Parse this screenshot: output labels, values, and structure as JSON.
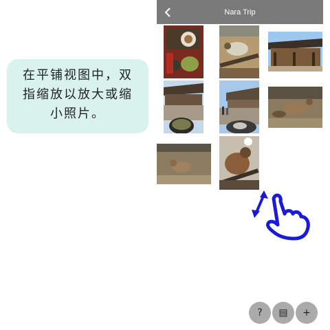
{
  "tooltip": {
    "lines": [
      "在平铺视图中，双",
      "指缩放以放大或缩",
      "小照片。"
    ]
  },
  "header": {
    "title": "Nara Trip",
    "back_icon": "chevron-left-icon"
  },
  "photos": [
    "photo-food-tray",
    "photo-deer-sheep",
    "photo-temple-gate",
    "photo-temple-hall",
    "photo-courtyard-people",
    "photo-deer-lying",
    "photo-deer-grass",
    "photo-deer-close",
    "photo-bowl-food"
  ],
  "fabs": [
    {
      "icon": "help-icon",
      "glyph": "?"
    },
    {
      "icon": "grid-view-icon",
      "glyph": "▤"
    },
    {
      "icon": "add-icon",
      "glyph": "+"
    }
  ],
  "colors": {
    "header": "#7a7a7a",
    "tooltip_bg": "#d9f2ee",
    "gesture": "#1a1adb",
    "fab": "#aaaaaa"
  }
}
